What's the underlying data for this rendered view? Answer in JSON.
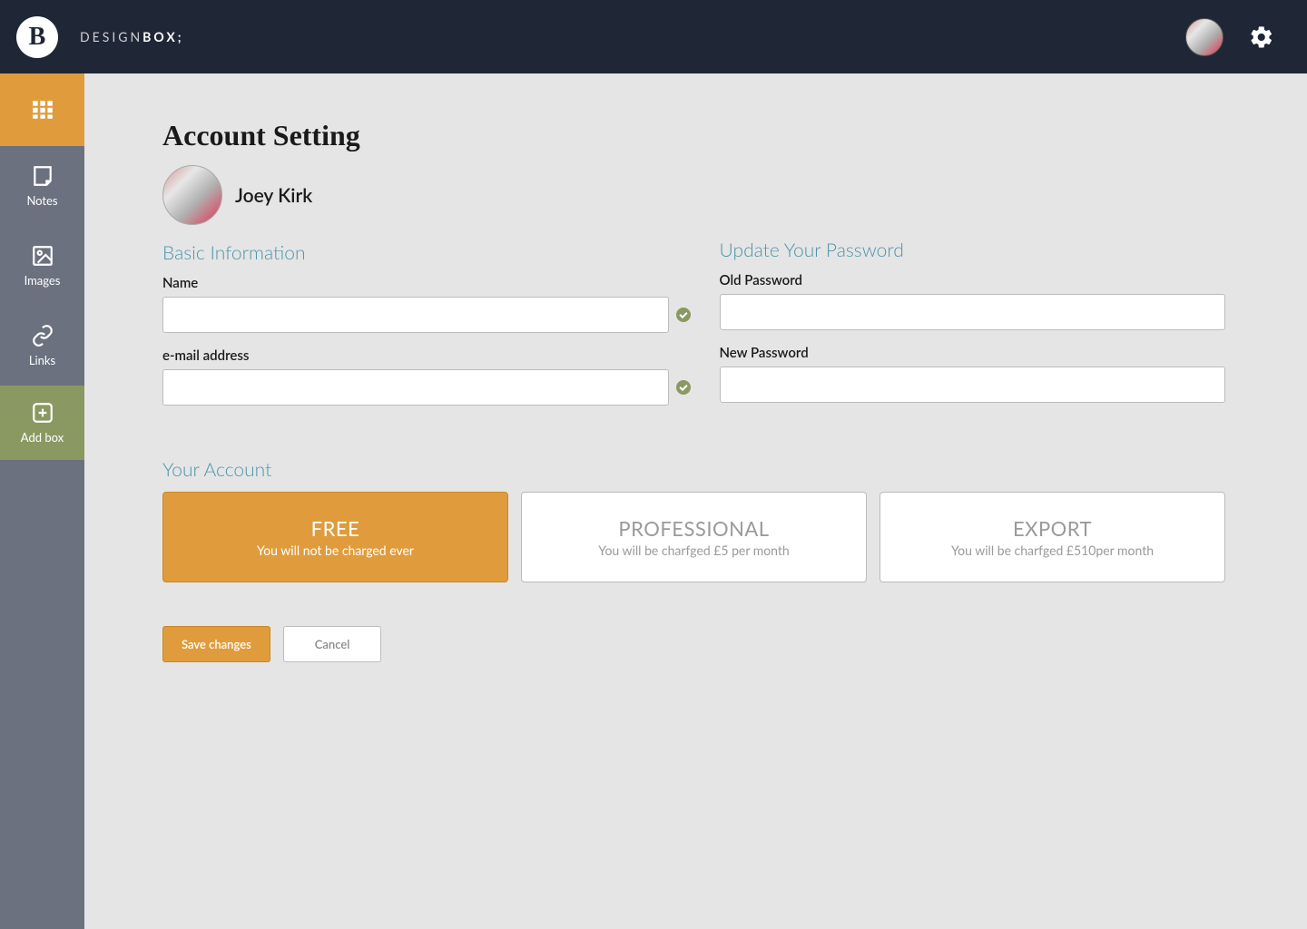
{
  "header": {
    "logo_letter": "B",
    "brand_light": "DESIGN",
    "brand_bold": "BOX;"
  },
  "sidebar": {
    "items": [
      {
        "label": ""
      },
      {
        "label": "Notes"
      },
      {
        "label": "Images"
      },
      {
        "label": "Links"
      },
      {
        "label": "Add  box"
      }
    ]
  },
  "page": {
    "title": "Account Setting",
    "user_name": "Joey Kirk"
  },
  "basic": {
    "section_title": "Basic Information",
    "name_label": "Name",
    "email_label": "e-mail address"
  },
  "password": {
    "section_title": "Update Your Password",
    "old_label": "Old Password",
    "new_label": "New Password"
  },
  "account": {
    "section_title": "Your Account",
    "plans": [
      {
        "title": "FREE",
        "sub": "You will not be charged ever"
      },
      {
        "title": "PROFESSIONAL",
        "sub": "You will be charfged   £5 per month"
      },
      {
        "title": "EXPORT",
        "sub": "You will be charfged   £510per month"
      }
    ]
  },
  "buttons": {
    "save": "Save changes",
    "cancel": "Cancel"
  }
}
